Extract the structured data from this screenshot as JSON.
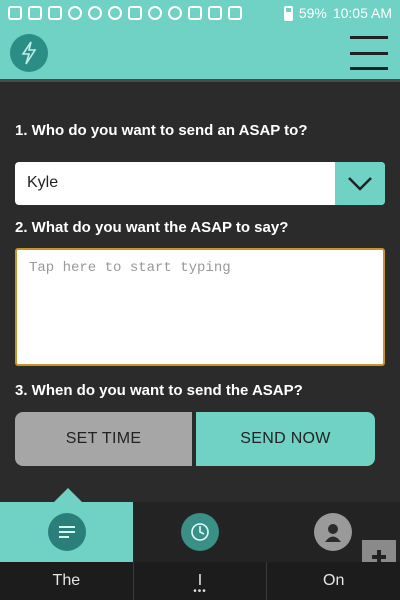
{
  "status_bar": {
    "battery": "59%",
    "time": "10:05 AM"
  },
  "header": {
    "logo_icon": "lightning-bolt-icon",
    "menu_icon": "hamburger-menu-icon"
  },
  "main": {
    "q1_label": "1. Who do you want to send an ASAP to?",
    "recipient_value": "Kyle",
    "q2_label": "2. What do you want the ASAP to say?",
    "message_placeholder": "Tap here to start typing",
    "q3_label": "3. When do you want to send the ASAP?",
    "set_time_label": "SET TIME",
    "send_now_label": "SEND NOW"
  },
  "tabs": [
    {
      "icon": "message-list-icon",
      "active": true
    },
    {
      "icon": "clock-chat-icon",
      "active": false
    },
    {
      "icon": "add-contact-icon",
      "active": false
    }
  ],
  "keyboard_suggestions": [
    "The",
    "I",
    "On"
  ],
  "colors": {
    "accent": "#6fd2c4",
    "background": "#2b2b2b",
    "button_gray": "#a6a6a6",
    "textarea_border": "#c7962a"
  }
}
